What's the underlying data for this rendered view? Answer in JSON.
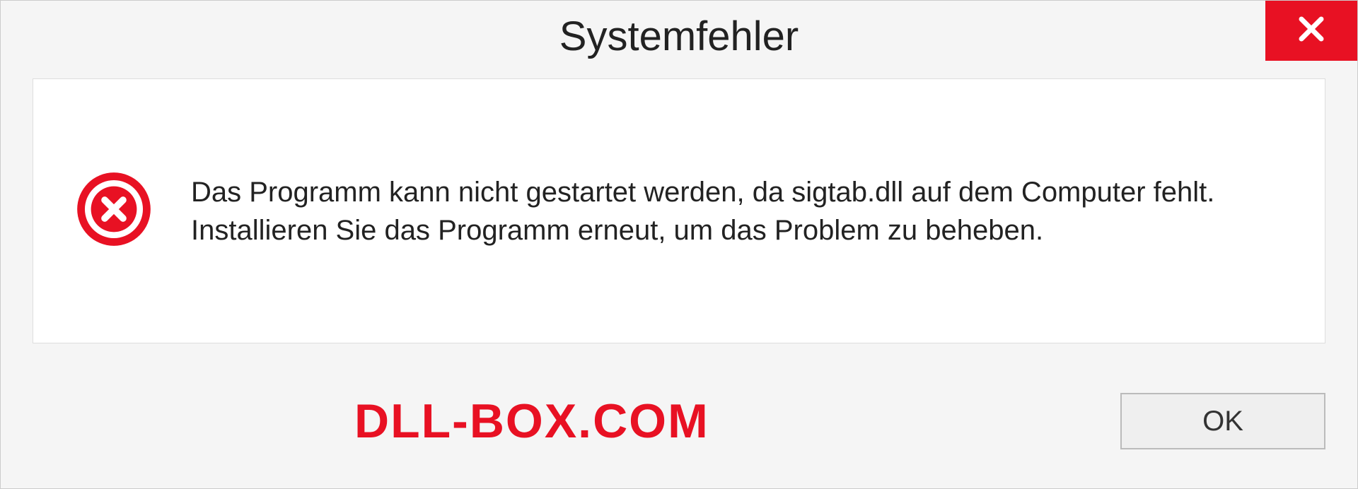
{
  "dialog": {
    "title": "Systemfehler",
    "message": "Das Programm kann nicht gestartet werden, da sigtab.dll auf dem Computer fehlt. Installieren Sie das Programm erneut, um das Problem zu beheben.",
    "ok_label": "OK"
  },
  "watermark": "DLL-BOX.COM",
  "colors": {
    "error_red": "#e81123",
    "background": "#f5f5f5",
    "content_bg": "#ffffff"
  }
}
